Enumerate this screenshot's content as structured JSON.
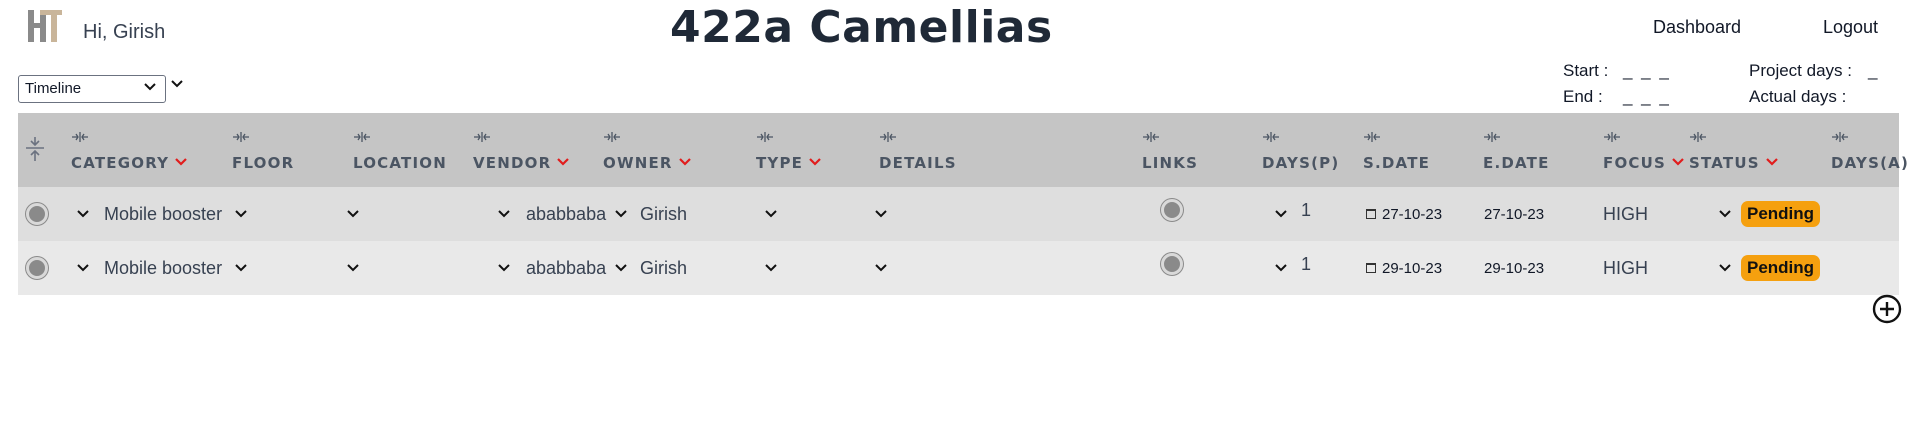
{
  "header": {
    "greeting": "Hi, Girish",
    "project_title": "422a Camellias",
    "nav": {
      "dashboard": "Dashboard",
      "logout": "Logout"
    },
    "stats": {
      "start_label": "Start :",
      "start_value": "_ _ _",
      "end_label": "End :",
      "end_value": "_ _ _",
      "project_days_label": "Project days :",
      "project_days_value": "_",
      "actual_days_label": "Actual days :",
      "actual_days_value": ""
    }
  },
  "view_select": {
    "selected": "Timeline"
  },
  "table": {
    "columns": {
      "category": "CATEGORY",
      "floor": "FLOOR",
      "location": "LOCATION",
      "vendor": "VENDOR",
      "owner": "OWNER",
      "type": "TYPE",
      "details": "DETAILS",
      "links": "LINKS",
      "days_p": "DAYS(P)",
      "s_date": "S.DATE",
      "e_date": "E.DATE",
      "focus": "FOCUS",
      "status": "STATUS",
      "days_a": "DAYS(A)"
    },
    "rows": [
      {
        "category": "Mobile booster",
        "vendor": "ababbaba",
        "owner": "Girish",
        "days_p": "1",
        "s_date": "27-10-23",
        "e_date": "27-10-23",
        "focus": "HIGH",
        "status": "Pending"
      },
      {
        "category": "Mobile booster",
        "vendor": "ababbaba",
        "owner": "Girish",
        "days_p": "1",
        "s_date": "29-10-23",
        "e_date": "29-10-23",
        "focus": "HIGH",
        "status": "Pending"
      }
    ]
  },
  "colors": {
    "header_bg": "#c5c5c5",
    "row1_bg": "#dedede",
    "row2_bg": "#e9e9e9",
    "sort_arrow": "#e11d1d",
    "status_pending": "#f5a00f"
  },
  "icons": {
    "logo": "ht-logo",
    "add": "plus-circle-icon",
    "resize": "column-resize-icon",
    "collapse": "collapse-rows-icon"
  }
}
